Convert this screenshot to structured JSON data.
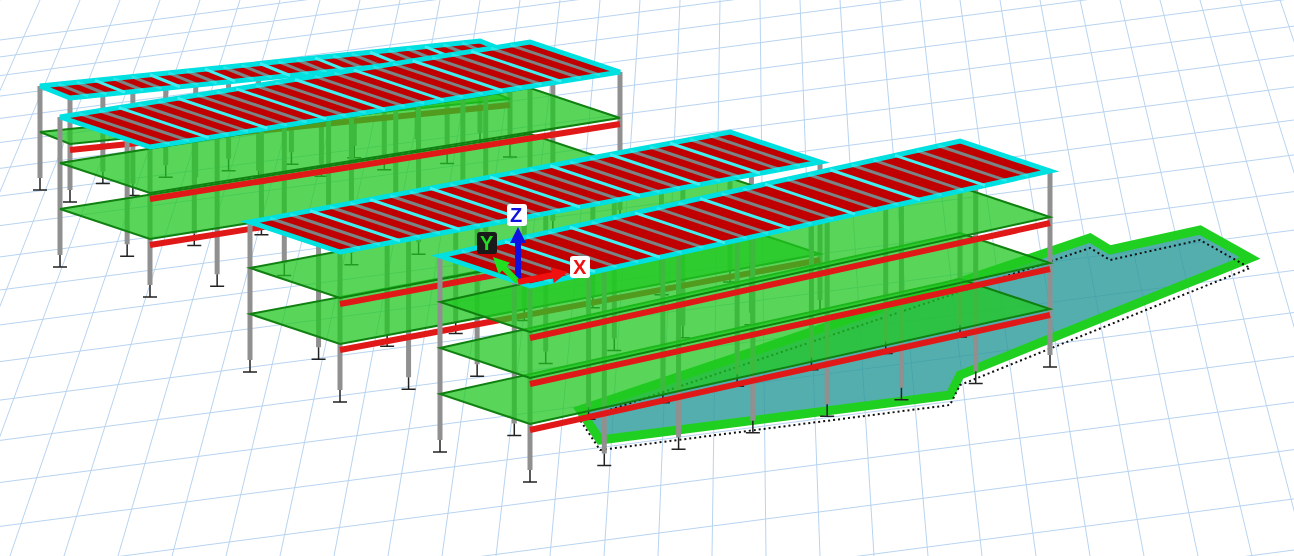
{
  "axes": [
    {
      "kind": "z",
      "label": "Z",
      "color": "#1010e0"
    },
    {
      "kind": "y",
      "label": "Y",
      "color": "#20e020"
    },
    {
      "kind": "x",
      "label": "X",
      "color": "#f01010"
    }
  ]
}
